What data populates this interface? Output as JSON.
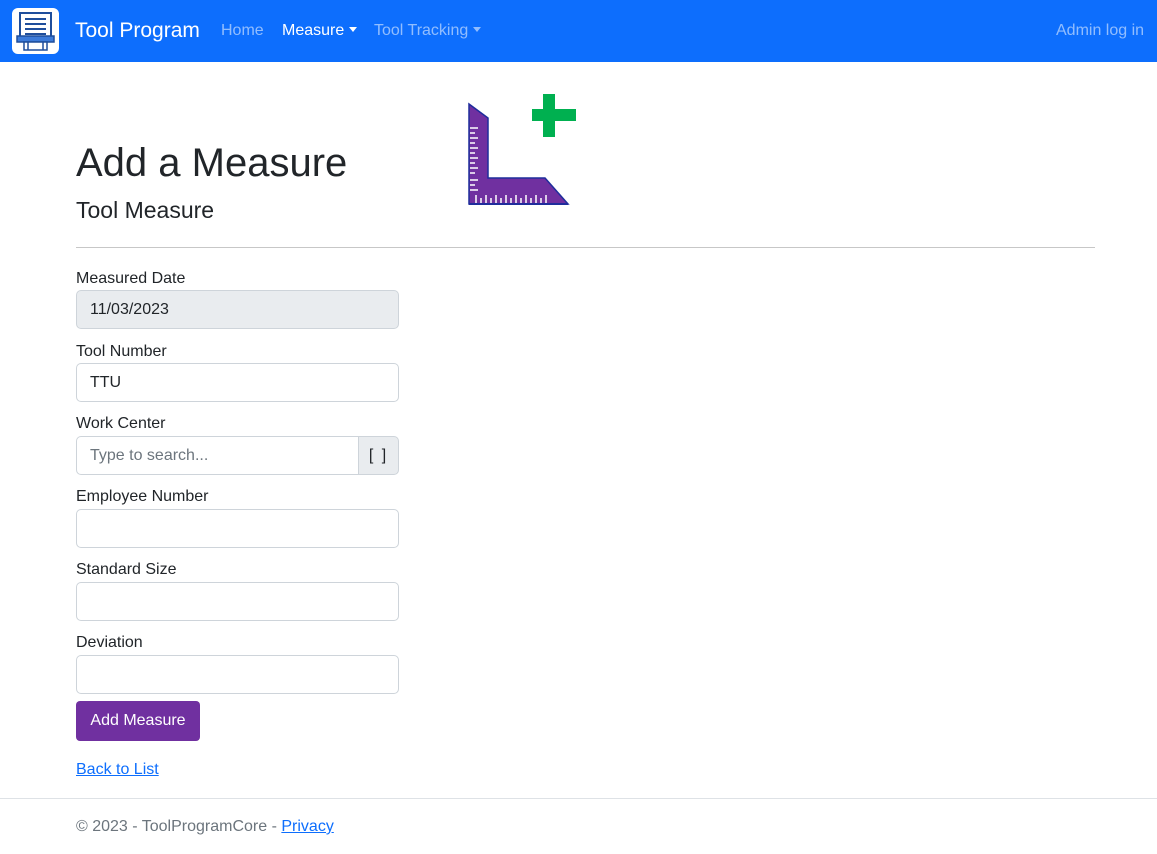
{
  "navbar": {
    "brand": "Tool Program",
    "links": [
      {
        "label": "Home"
      },
      {
        "label": "Measure"
      },
      {
        "label": "Tool Tracking"
      }
    ],
    "admin_label": "Admin log in"
  },
  "header": {
    "title": "Add a Measure",
    "subtitle": "Tool Measure"
  },
  "form": {
    "measured_date": {
      "label": "Measured Date",
      "value": "11/03/2023"
    },
    "tool_number": {
      "label": "Tool Number",
      "value": "TTU"
    },
    "work_center": {
      "label": "Work Center",
      "placeholder": "Type to search...",
      "addon": "[ ]"
    },
    "employee_number": {
      "label": "Employee Number",
      "value": ""
    },
    "standard_size": {
      "label": "Standard Size",
      "value": ""
    },
    "deviation": {
      "label": "Deviation",
      "value": ""
    },
    "submit_label": "Add Measure",
    "back_label": "Back to List"
  },
  "footer": {
    "text": "© 2023 - ToolProgramCore - ",
    "privacy_label": "Privacy"
  },
  "colors": {
    "navbar": "#0d6efd",
    "submit": "#7030a0",
    "ruler": "#7030a0",
    "plus": "#00b050",
    "link": "#0d6efd"
  },
  "icons": {
    "brand": "document-printer-icon",
    "hero": "ruler-square-plus-icon"
  }
}
